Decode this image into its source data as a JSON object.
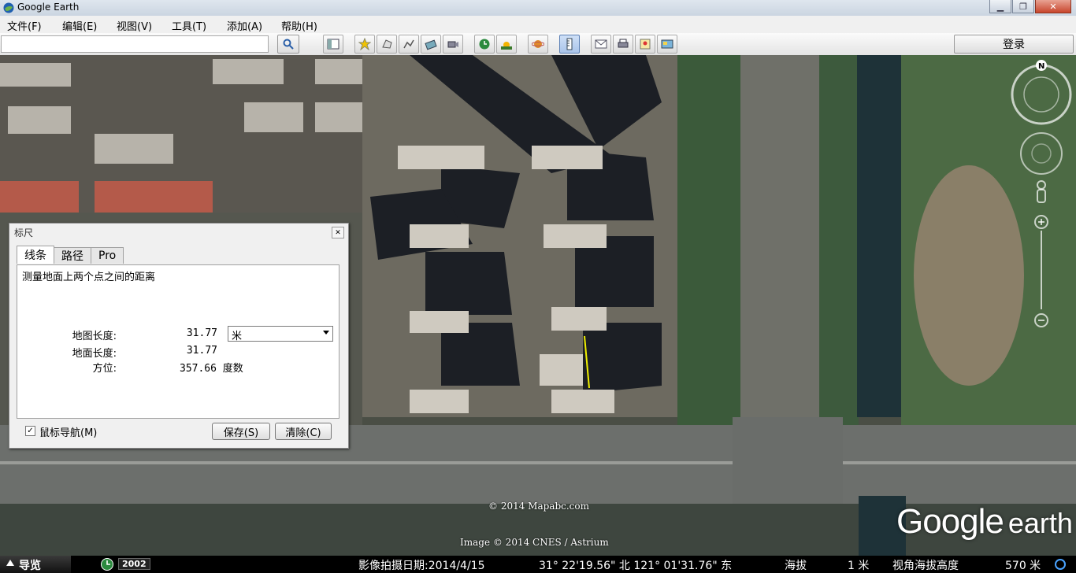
{
  "window": {
    "title": "Google Earth"
  },
  "menu": [
    "文件(F)",
    "编辑(E)",
    "视图(V)",
    "工具(T)",
    "添加(A)",
    "帮助(H)"
  ],
  "toolbar": {
    "search_value": "",
    "login_label": "登录",
    "icons": [
      "sidebar-toggle-icon",
      "placemark-icon",
      "polygon-icon",
      "path-icon",
      "image-overlay-icon",
      "record-tour-icon",
      "historical-imagery-icon",
      "sunlight-icon",
      "planets-icon",
      "ruler-icon",
      "email-icon",
      "print-icon",
      "view-in-maps-icon",
      "save-image-icon"
    ]
  },
  "ruler": {
    "title": "标尺",
    "tabs": [
      "线条",
      "路径",
      "Pro"
    ],
    "active_tab": "线条",
    "description": "测量地面上两个点之间的距离",
    "map_length_label": "地图长度:",
    "map_length_value": "31.77",
    "unit": "米",
    "ground_length_label": "地面长度:",
    "ground_length_value": "31.77",
    "heading_label": "方位:",
    "heading_value": "357.66 度数",
    "mouse_nav_checked": true,
    "mouse_nav_label": "鼠标导航(M)",
    "save_label": "保存(S)",
    "clear_label": "清除(C)"
  },
  "map": {
    "copyright1": "© 2014 Mapabc.com",
    "copyright2": "Image © 2014 CNES / Astrium",
    "logo_text_1": "Google",
    "logo_text_2": "earth",
    "measure_line_color": "#f0f000"
  },
  "status": {
    "nav_label": "导览",
    "year": "2002",
    "imagery_date": "影像拍摄日期:2014/4/15",
    "coords": "31° 22'19.56\" 北 121° 01'31.76\" 东",
    "elev_label": "海拔",
    "elev_value": "1 米",
    "eye_alt_label": "视角海拔高度",
    "eye_alt_value": "570 米"
  }
}
